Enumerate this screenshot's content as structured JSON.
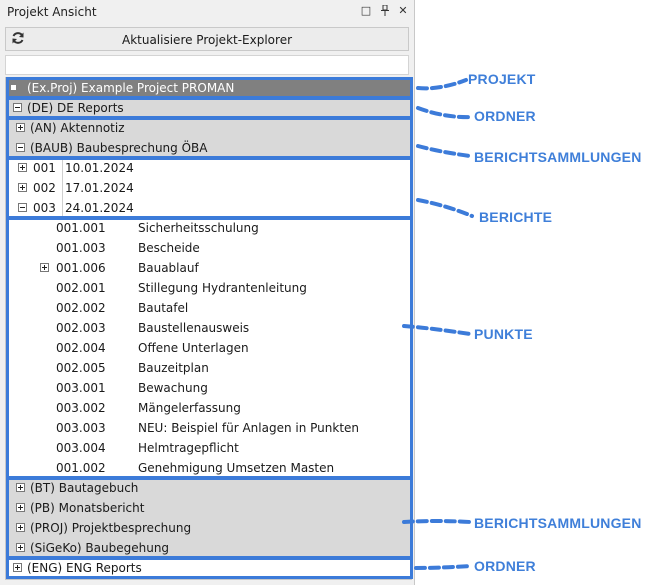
{
  "panel": {
    "title": "Projekt Ansicht",
    "window_buttons": {
      "maximize": "□",
      "pin": "▪",
      "close": "✕"
    },
    "refresh_label": "Aktualisiere Projekt-Explorer"
  },
  "tree": {
    "project": "(Ex.Proj) Example Project PROMAN",
    "folder_de": "(DE) DE Reports",
    "an": "(AN) Aktennotiz",
    "baub": "(BAUB) Baubesprechung ÖBA",
    "reports": [
      {
        "num": "001",
        "date": "10.01.2024",
        "expanded": false
      },
      {
        "num": "002",
        "date": "17.01.2024",
        "expanded": false
      },
      {
        "num": "003",
        "date": "24.01.2024",
        "expanded": true
      }
    ],
    "points": [
      {
        "code": "001.001",
        "title": "Sicherheitsschulung",
        "expandable": false
      },
      {
        "code": "001.003",
        "title": "Bescheide",
        "expandable": false
      },
      {
        "code": "001.006",
        "title": "Bauablauf",
        "expandable": true
      },
      {
        "code": "002.001",
        "title": "Stillegung Hydrantenleitung",
        "expandable": false
      },
      {
        "code": "002.002",
        "title": "Bautafel",
        "expandable": false
      },
      {
        "code": "002.003",
        "title": "Baustellenausweis",
        "expandable": false
      },
      {
        "code": "002.004",
        "title": "Offene Unterlagen",
        "expandable": false
      },
      {
        "code": "002.005",
        "title": "Bauzeitplan",
        "expandable": false
      },
      {
        "code": "003.001",
        "title": "Bewachung",
        "expandable": false
      },
      {
        "code": "003.002",
        "title": "Mängelerfassung",
        "expandable": false
      },
      {
        "code": "003.003",
        "title": "NEU: Beispiel für Anlagen in Punkten",
        "expandable": false
      },
      {
        "code": "003.004",
        "title": "Helmtragepflicht",
        "expandable": false
      },
      {
        "code": "001.002",
        "title": "Genehmigung Umsetzen Masten",
        "expandable": false
      }
    ],
    "collections": [
      "(BT) Bautagebuch",
      "(PB) Monatsbericht",
      "(PROJ) Projektbesprechung",
      "(SiGeKo) Baubegehung"
    ],
    "folder_eng": "(ENG) ENG Reports"
  },
  "annotations": {
    "projekt": "PROJEKT",
    "ordner1": "ORDNER",
    "berichtsammlungen1": "BERICHTSAMMLUNGEN",
    "berichte": "BERICHTE",
    "punkte": "PUNKTE",
    "berichtsammlungen2": "BERICHTSAMMLUNGEN",
    "ordner2": "ORDNER"
  },
  "colors": {
    "accent": "#3c7bd9",
    "project_row": "#808080",
    "selected_gray": "#d9d9d9",
    "panel_bg": "#f0f0f0"
  }
}
